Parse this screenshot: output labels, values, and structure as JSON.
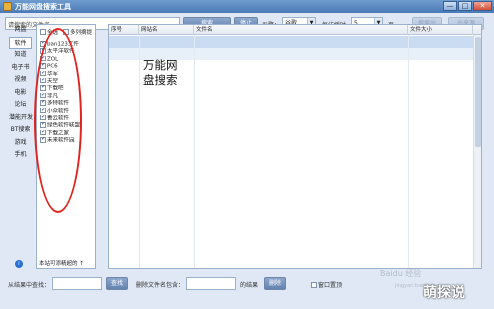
{
  "window": {
    "title": "万能网盘搜索工具",
    "minimize": "—",
    "maximize": "□",
    "close": "✕"
  },
  "toolbar": {
    "search_placeholder": "请搜索的文件名",
    "search_button": "搜索",
    "stop_button": "停止",
    "engine_label": "引擎：",
    "engine_value": "谷歌",
    "interval_label": "每访缓时",
    "interval_value": "5",
    "page_label": "页",
    "disabled_btn_1": "搜索出",
    "disabled_btn_2": "出来源"
  },
  "sidebar": {
    "items": [
      {
        "label": "网盘",
        "active": false
      },
      {
        "label": "软件",
        "active": true
      },
      {
        "label": "知道",
        "active": false
      },
      {
        "label": "电子书",
        "active": false
      },
      {
        "label": "视频",
        "active": false
      },
      {
        "label": "电影",
        "active": false
      },
      {
        "label": "论坛",
        "active": false
      },
      {
        "label": "潜能开发",
        "active": false
      },
      {
        "label": "BT搜索",
        "active": false
      },
      {
        "label": "游戏",
        "active": false
      },
      {
        "label": "手机",
        "active": false
      }
    ]
  },
  "sites_panel": {
    "select_all": "全选",
    "multi_select": "多列摘提",
    "sites": [
      "ban123文件",
      "太平洋软件",
      "ZOL",
      "PC6",
      "华军",
      "天空",
      "下载吧",
      "非凡",
      "多特软件",
      "小众软件",
      "善云软件",
      "绿色软件联盟",
      "下载之家",
      "未来软件园"
    ],
    "add_link": "本站可添精超的 ↑"
  },
  "results": {
    "columns": [
      "序号",
      "网站名",
      "文件名",
      "文件大小"
    ],
    "overlay_text": "万能网盘搜索"
  },
  "bottombar": {
    "from_label": "从结果中查找：",
    "find_button": "查找",
    "delete_label": "删除文件名包含：",
    "result_suffix": "的结果",
    "delete_button": "删除",
    "top_window_label": "窗口置顶"
  },
  "watermark": {
    "text": "Baidu 经验",
    "url": "jingyan.baidu.com",
    "corner_logo": "萌探说"
  }
}
